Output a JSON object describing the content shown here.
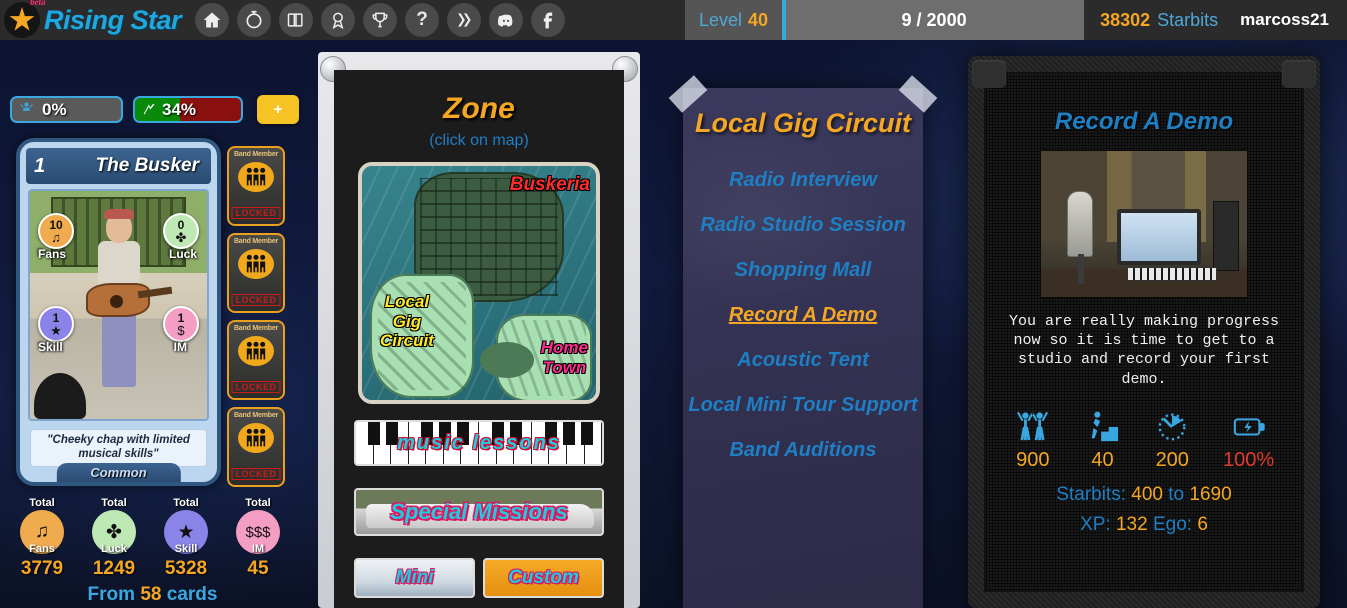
{
  "header": {
    "logo_text": "Rising Star",
    "logo_badge": "beta",
    "nav_icons": [
      {
        "name": "home-icon",
        "label": "Home"
      },
      {
        "name": "stopwatch-icon",
        "label": "Missions Timer"
      },
      {
        "name": "cards-icon",
        "label": "Cards"
      },
      {
        "name": "medal-icon",
        "label": "Achievements"
      },
      {
        "name": "trophy-icon",
        "label": "Leaderboard"
      },
      {
        "name": "help-icon",
        "label": "Help"
      },
      {
        "name": "hive-icon",
        "label": "Hive"
      },
      {
        "name": "discord-icon",
        "label": "Discord"
      },
      {
        "name": "facebook-icon",
        "label": "Facebook"
      }
    ],
    "level_label": "Level",
    "level_value": "40",
    "xp_progress": "9 / 2000",
    "starbits_value": "38302",
    "starbits_label": "Starbits",
    "username": "marcoss21"
  },
  "left": {
    "fans_bar": {
      "icon": "fans-icon",
      "value": "0%"
    },
    "energy_bar": {
      "icon": "energy-icon",
      "value": "34%"
    },
    "plus_button": "+",
    "card": {
      "number": "1",
      "name": "The Busker",
      "stats": [
        {
          "name": "Fans",
          "value": "10",
          "glyph": "♫"
        },
        {
          "name": "Luck",
          "value": "0",
          "glyph": "✤"
        },
        {
          "name": "Skill",
          "value": "1",
          "glyph": "★"
        },
        {
          "name": "IM",
          "value": "1",
          "glyph": "$"
        }
      ],
      "quote": "\"Cheeky chap with limited musical skills\"",
      "rarity": "Common"
    },
    "band_slots": [
      {
        "title": "Band Member",
        "status": "LOCKED"
      },
      {
        "title": "Band Member",
        "status": "LOCKED"
      },
      {
        "title": "Band Member",
        "status": "LOCKED"
      },
      {
        "title": "Band Member",
        "status": "LOCKED"
      }
    ],
    "totals": [
      {
        "prefix": "Total",
        "name": "Fans",
        "value": "3779",
        "color": "#f0ab4e"
      },
      {
        "prefix": "Total",
        "name": "Luck",
        "value": "1249",
        "color": "#bfe9b4"
      },
      {
        "prefix": "Total",
        "name": "Skill",
        "value": "5328",
        "color": "#8a84e8"
      },
      {
        "prefix": "Total",
        "name": "IM",
        "value": "45",
        "color": "#f59ec4"
      }
    ],
    "from_cards_prefix": "From",
    "from_cards_count": "58",
    "from_cards_suffix": "cards"
  },
  "zone": {
    "title": "Zone",
    "subtitle": "(click on map)",
    "map_labels": [
      {
        "name": "Buskeria",
        "color": "#ff2b2b"
      },
      {
        "name": "Local Gig Circuit",
        "color": "#ffe92b"
      },
      {
        "name": "Home Town",
        "color": "#ff2b8f"
      }
    ],
    "buttons": {
      "music_lessons": "music lessons",
      "special_missions": "Special Missions",
      "mini": "Mini",
      "custom": "Custom"
    }
  },
  "poster": {
    "title": "Local Gig Circuit",
    "items": [
      {
        "label": "Radio Interview",
        "active": false
      },
      {
        "label": "Radio Studio Session",
        "active": false
      },
      {
        "label": "Shopping Mall",
        "active": false
      },
      {
        "label": "Record A Demo",
        "active": true
      },
      {
        "label": "Acoustic Tent",
        "active": false
      },
      {
        "label": "Local Mini Tour Support",
        "active": false
      },
      {
        "label": "Band Auditions",
        "active": false
      }
    ]
  },
  "amp": {
    "title": "Record A Demo",
    "photo_alt": "recording-studio-photo",
    "description": "You are really making progress now so it is time to get to a studio and record your first demo.",
    "stats": [
      {
        "icon": "fans-crowd-icon",
        "value": "900",
        "meaning": "fans"
      },
      {
        "icon": "skill-stairs-icon",
        "value": "40",
        "meaning": "skill"
      },
      {
        "icon": "timer-icon",
        "value": "200",
        "meaning": "minutes"
      },
      {
        "icon": "battery-icon",
        "value": "100%",
        "meaning": "energy",
        "color": "#e03a2f"
      }
    ],
    "starbits_label": "Starbits:",
    "starbits_min": "400",
    "starbits_to": "to",
    "starbits_max": "1690",
    "xp_label": "XP:",
    "xp_value": "132",
    "ego_label": "Ego:",
    "ego_value": "6"
  }
}
